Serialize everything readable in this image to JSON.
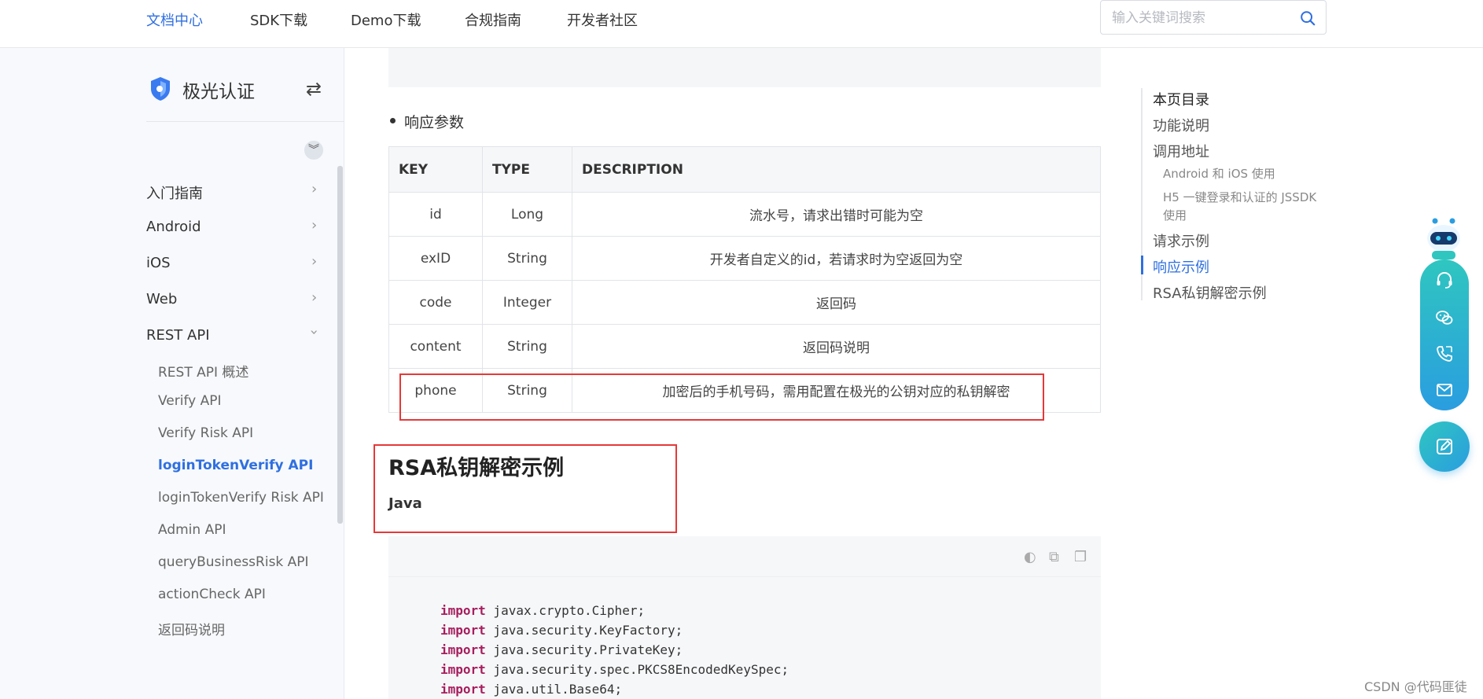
{
  "nav": {
    "items": [
      "文档中心",
      "SDK下载",
      "Demo下载",
      "合规指南",
      "开发者社区"
    ],
    "search_placeholder": "输入关键词搜索"
  },
  "sidebar": {
    "brand": "极光认证",
    "sections": [
      {
        "label": "入门指南",
        "expanded": false
      },
      {
        "label": "Android",
        "expanded": false
      },
      {
        "label": "iOS",
        "expanded": false
      },
      {
        "label": "Web",
        "expanded": false
      },
      {
        "label": "REST API",
        "expanded": true
      }
    ],
    "sub_items": [
      "REST API 概述",
      "Verify API",
      "Verify Risk API",
      "loginTokenVerify API",
      "loginTokenVerify Risk API",
      "Admin API",
      "queryBusinessRisk API",
      "actionCheck API",
      "返回码说明"
    ],
    "active_sub": "loginTokenVerify API"
  },
  "content": {
    "bullet": "响应参数",
    "table": {
      "headers": [
        "KEY",
        "TYPE",
        "DESCRIPTION"
      ],
      "rows": [
        [
          "id",
          "Long",
          "流水号，请求出错时可能为空"
        ],
        [
          "exID",
          "String",
          "开发者自定义的id，若请求时为空返回为空"
        ],
        [
          "code",
          "Integer",
          "返回码"
        ],
        [
          "content",
          "String",
          "返回码说明"
        ],
        [
          "phone",
          "String",
          "加密后的手机号码，需用配置在极光的公钥对应的私钥解密"
        ]
      ]
    },
    "heading": "RSA私钥解密示例",
    "subheading": "Java",
    "code_lines": [
      {
        "kw": "import",
        "rest": " javax.crypto.Cipher;"
      },
      {
        "kw": "import",
        "rest": " java.security.KeyFactory;"
      },
      {
        "kw": "import",
        "rest": " java.security.PrivateKey;"
      },
      {
        "kw": "import",
        "rest": " java.security.spec.PKCS8EncodedKeySpec;"
      },
      {
        "kw": "import",
        "rest": " java.util.Base64;"
      }
    ]
  },
  "toc": {
    "title": "本页目录",
    "items": [
      {
        "label": "功能说明",
        "level": 1
      },
      {
        "label": "调用地址",
        "level": 1
      },
      {
        "label": "Android 和 iOS 使用",
        "level": 2
      },
      {
        "label": "H5 一键登录和认证的 JSSDK",
        "level": 2
      },
      {
        "label": "使用",
        "level": 2
      },
      {
        "label": "请求示例",
        "level": 1
      },
      {
        "label": "响应示例",
        "level": 1,
        "active": true
      },
      {
        "label": "RSA私钥解密示例",
        "level": 1
      }
    ]
  },
  "watermark": "CSDN @代码匪徒",
  "colors": {
    "accent": "#2f6fe0",
    "highlight_box": "#e63838",
    "float_gradient_start": "#2fc6c0",
    "float_gradient_end": "#2a9de0"
  }
}
